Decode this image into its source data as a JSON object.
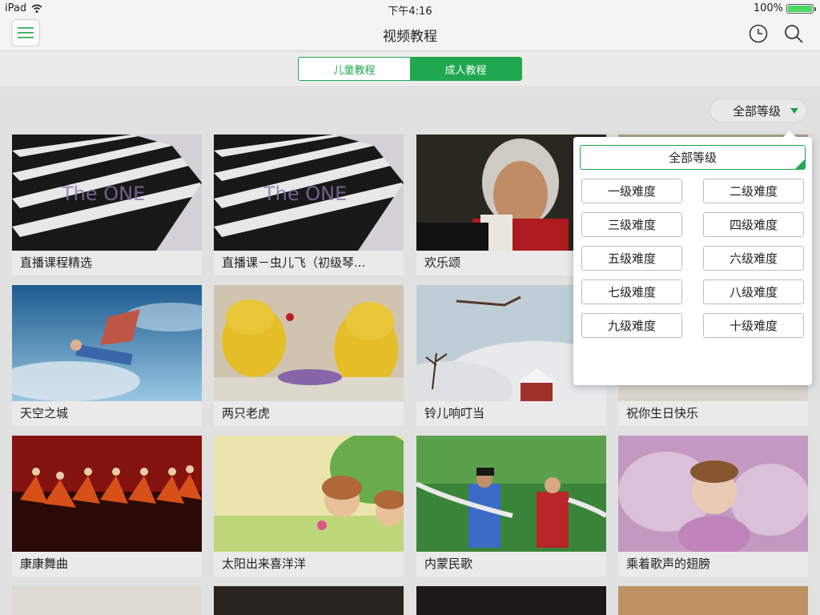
{
  "status_bar": {
    "device": "iPad",
    "time": "下午4:16",
    "battery": "100%"
  },
  "nav": {
    "title": "视频教程"
  },
  "tabs": [
    {
      "label": "儿童教程",
      "active": false
    },
    {
      "label": "成人教程",
      "active": true
    }
  ],
  "filter": {
    "selected": "全部等级"
  },
  "dropdown": {
    "all": "全部等级",
    "levels": [
      "一级难度",
      "二级难度",
      "三级难度",
      "四级难度",
      "五级难度",
      "六级难度",
      "七级难度",
      "八级难度",
      "九级难度",
      "十级难度"
    ]
  },
  "cards": [
    {
      "title": "直播课程精选"
    },
    {
      "title": "直播课－虫儿飞（初级琴..."
    },
    {
      "title": "欢乐颂"
    },
    {
      "title": ""
    },
    {
      "title": "天空之城"
    },
    {
      "title": "两只老虎"
    },
    {
      "title": "铃儿响叮当"
    },
    {
      "title": "祝你生日快乐"
    },
    {
      "title": "康康舞曲"
    },
    {
      "title": "太阳出来喜洋洋"
    },
    {
      "title": "内蒙民歌"
    },
    {
      "title": "乘着歌声的翅膀"
    }
  ],
  "theme": {
    "accent": "#1fa84f"
  }
}
